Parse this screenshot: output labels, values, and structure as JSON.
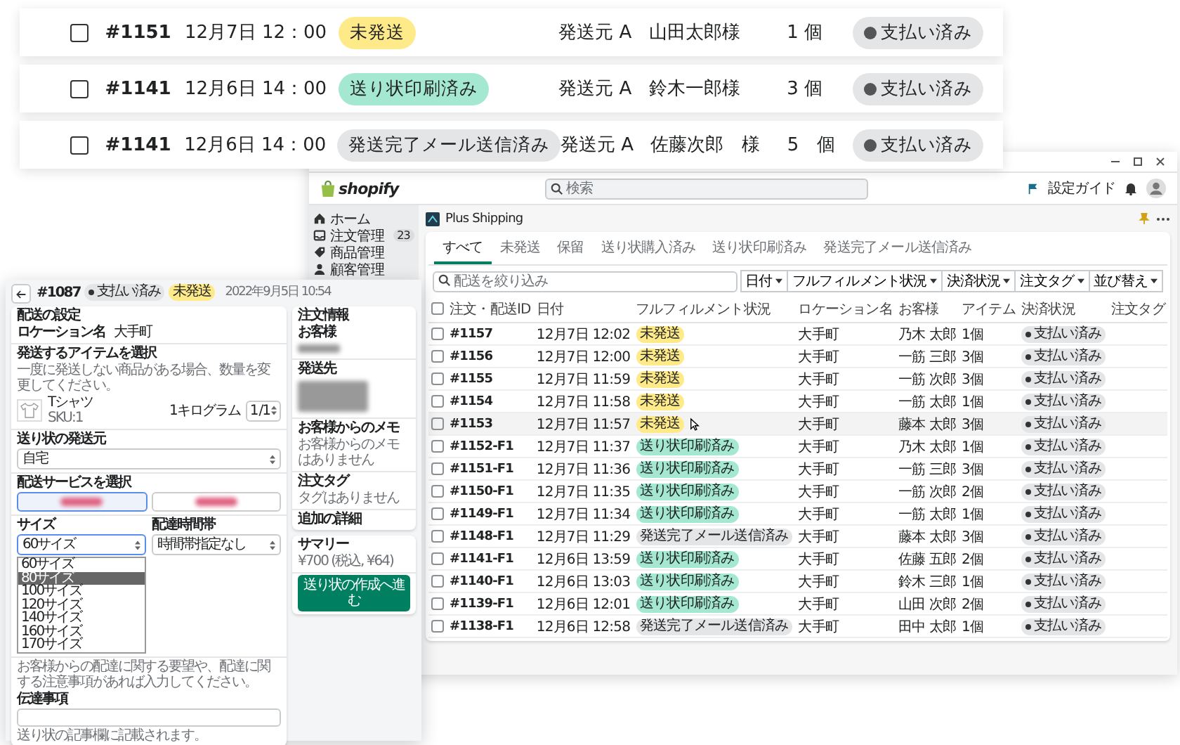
{
  "order_cards": [
    {
      "checked": false,
      "order": "#1151",
      "date": "12月7日 12：00",
      "fulfillment": {
        "label": "未発送",
        "kind": "unfulfilled"
      },
      "origin": "発送元 A",
      "customer": "山田太郎様",
      "quantity": "1 個",
      "payment": "支払い済み"
    },
    {
      "checked": false,
      "order": "#1141",
      "date": "12月6日 14：00",
      "fulfillment": {
        "label": "送り状印刷済み",
        "kind": "label_printed"
      },
      "origin": "発送元 A",
      "customer": "鈴木一郎様",
      "quantity": "3 個",
      "payment": "支払い済み"
    },
    {
      "checked": false,
      "order": "#1141",
      "date": "12月6日 14：00",
      "fulfillment": {
        "label": "発送完了メール送信済み",
        "kind": "email_sent"
      },
      "origin": "発送元 A",
      "customer": "佐藤次郎　様",
      "quantity": "5　個",
      "payment": "支払い済み"
    }
  ],
  "admin": {
    "brand": "shopify",
    "search_placeholder": "検索",
    "setup_guide": "設定ガイド",
    "nav": [
      {
        "label": "ホーム"
      },
      {
        "label": "注文管理",
        "count": "23"
      },
      {
        "label": "商品管理"
      },
      {
        "label": "顧客管理"
      }
    ],
    "app_title": "Plus Shipping",
    "tabs": [
      {
        "label": "すべて",
        "selected": true
      },
      {
        "label": "未発送",
        "selected": false
      },
      {
        "label": "保留",
        "selected": false
      },
      {
        "label": "送り状購入済み",
        "selected": false
      },
      {
        "label": "送り状印刷済み",
        "selected": false
      },
      {
        "label": "発送完了メール送信済み",
        "selected": false
      }
    ],
    "filter_placeholder": "配送を絞り込み",
    "filters": [
      "日付",
      "フルフィルメント状況",
      "決済状況",
      "注文タグ",
      "並び替え"
    ],
    "table": {
      "all_checked": false,
      "columns": [
        "注文・配送ID",
        "日付",
        "フルフィルメント状況",
        "ロケーション名",
        "お客様",
        "アイテム",
        "決済状況",
        "注文タグ"
      ],
      "rows": [
        {
          "checked": false,
          "id": "#1157",
          "date": "12月7日 12:02",
          "fulfillment": {
            "label": "未発送",
            "kind": "unfulfilled"
          },
          "location": "大手町",
          "customer": "乃木 太郎",
          "items": "1個",
          "payment": "支払い済み",
          "hovered": false
        },
        {
          "checked": false,
          "id": "#1156",
          "date": "12月7日 12:00",
          "fulfillment": {
            "label": "未発送",
            "kind": "unfulfilled"
          },
          "location": "大手町",
          "customer": "一筋 三郎",
          "items": "3個",
          "payment": "支払い済み",
          "hovered": false
        },
        {
          "checked": false,
          "id": "#1155",
          "date": "12月7日 11:59",
          "fulfillment": {
            "label": "未発送",
            "kind": "unfulfilled"
          },
          "location": "大手町",
          "customer": "一筋 次郎",
          "items": "3個",
          "payment": "支払い済み",
          "hovered": false
        },
        {
          "checked": false,
          "id": "#1154",
          "date": "12月7日 11:58",
          "fulfillment": {
            "label": "未発送",
            "kind": "unfulfilled"
          },
          "location": "大手町",
          "customer": "一筋 太郎",
          "items": "1個",
          "payment": "支払い済み",
          "hovered": false
        },
        {
          "checked": false,
          "id": "#1153",
          "date": "12月7日 11:57",
          "fulfillment": {
            "label": "未発送",
            "kind": "unfulfilled"
          },
          "location": "大手町",
          "customer": "藤本 太郎",
          "items": "3個",
          "payment": "支払い済み",
          "hovered": true
        },
        {
          "checked": false,
          "id": "#1152-F1",
          "date": "12月7日 11:37",
          "fulfillment": {
            "label": "送り状印刷済み",
            "kind": "label_printed"
          },
          "location": "大手町",
          "customer": "乃木 太郎",
          "items": "1個",
          "payment": "支払い済み",
          "hovered": false
        },
        {
          "checked": false,
          "id": "#1151-F1",
          "date": "12月7日 11:36",
          "fulfillment": {
            "label": "送り状印刷済み",
            "kind": "label_printed"
          },
          "location": "大手町",
          "customer": "一筋 三郎",
          "items": "3個",
          "payment": "支払い済み",
          "hovered": false
        },
        {
          "checked": false,
          "id": "#1150-F1",
          "date": "12月7日 11:35",
          "fulfillment": {
            "label": "送り状印刷済み",
            "kind": "label_printed"
          },
          "location": "大手町",
          "customer": "一筋 次郎",
          "items": "2個",
          "payment": "支払い済み",
          "hovered": false
        },
        {
          "checked": false,
          "id": "#1149-F1",
          "date": "12月7日 11:34",
          "fulfillment": {
            "label": "送り状印刷済み",
            "kind": "label_printed"
          },
          "location": "大手町",
          "customer": "一筋 太郎",
          "items": "1個",
          "payment": "支払い済み",
          "hovered": false
        },
        {
          "checked": false,
          "id": "#1148-F1",
          "date": "12月7日 11:29",
          "fulfillment": {
            "label": "発送完了メール送信済み",
            "kind": "email_sent"
          },
          "location": "大手町",
          "customer": "藤本 太郎",
          "items": "3個",
          "payment": "支払い済み",
          "hovered": false
        },
        {
          "checked": false,
          "id": "#1141-F1",
          "date": "12月6日 13:59",
          "fulfillment": {
            "label": "送り状印刷済み",
            "kind": "label_printed"
          },
          "location": "大手町",
          "customer": "佐藤 五郎",
          "items": "2個",
          "payment": "支払い済み",
          "hovered": false
        },
        {
          "checked": false,
          "id": "#1140-F1",
          "date": "12月6日 13:03",
          "fulfillment": {
            "label": "送り状印刷済み",
            "kind": "label_printed"
          },
          "location": "大手町",
          "customer": "鈴木 三郎",
          "items": "1個",
          "payment": "支払い済み",
          "hovered": false
        },
        {
          "checked": false,
          "id": "#1139-F1",
          "date": "12月6日 12:01",
          "fulfillment": {
            "label": "送り状印刷済み",
            "kind": "label_printed"
          },
          "location": "大手町",
          "customer": "山田 次郎",
          "items": "2個",
          "payment": "支払い済み",
          "hovered": false
        },
        {
          "checked": false,
          "id": "#1138-F1",
          "date": "12月6日 12:58",
          "fulfillment": {
            "label": "発送完了メール送信済み",
            "kind": "email_sent"
          },
          "location": "大手町",
          "customer": "田中 太郎",
          "items": "1個",
          "payment": "支払い済み",
          "hovered": false
        }
      ]
    }
  },
  "order_detail": {
    "order": "#1087",
    "payment": "支払い済み",
    "fulfillment": {
      "label": "未発送",
      "kind": "unfulfilled"
    },
    "date": "2022年9月5日 10:54",
    "shipping": {
      "title": "配送の設定",
      "location_label": "ロケーション名",
      "location": "大手町",
      "items_title": "発送するアイテムを選択",
      "items_note": "一度に発送しない商品がある場合、数量を変更してください。",
      "item": {
        "name": "Tシャツ",
        "sku": "SKU:1",
        "weight": "1キログラム",
        "quantity": "1",
        "quantity_max": "/1"
      },
      "origin_label": "送り状の発送元",
      "origin": "自宅",
      "service_label": "配送サービスを選択",
      "services": [
        {
          "selected": true
        },
        {
          "selected": false
        }
      ],
      "size_label": "サイズ",
      "size": "60サイズ",
      "size_options": [
        {
          "label": "60サイズ",
          "selected": false
        },
        {
          "label": "80サイズ",
          "selected": true
        },
        {
          "label": "100サイズ",
          "selected": false
        },
        {
          "label": "120サイズ",
          "selected": false
        },
        {
          "label": "140サイズ",
          "selected": false
        },
        {
          "label": "160サイズ",
          "selected": false
        },
        {
          "label": "170サイズ",
          "selected": false
        }
      ],
      "time_label": "配達時間帯",
      "time": "時間帯指定なし",
      "notes_hint": "お客様からの配達に関する要望や、配達に関する注意事項があれば入力してください。",
      "notes_label": "伝達事項",
      "notes_help": "送り状の記事欄に記載されます。"
    },
    "sidebar": {
      "title": "注文情報",
      "customer_label": "お客様",
      "address_label": "発送先",
      "memo_label": "お客様からのメモ",
      "memo": "お客様からのメモはありません",
      "tags_label": "注文タグ",
      "tags": "タグはありません",
      "details_label": "追加の詳細",
      "summary_title": "サマリー",
      "summary": "¥700 (税込, ¥64)",
      "create_button": "送り状の作成へ進む"
    }
  }
}
